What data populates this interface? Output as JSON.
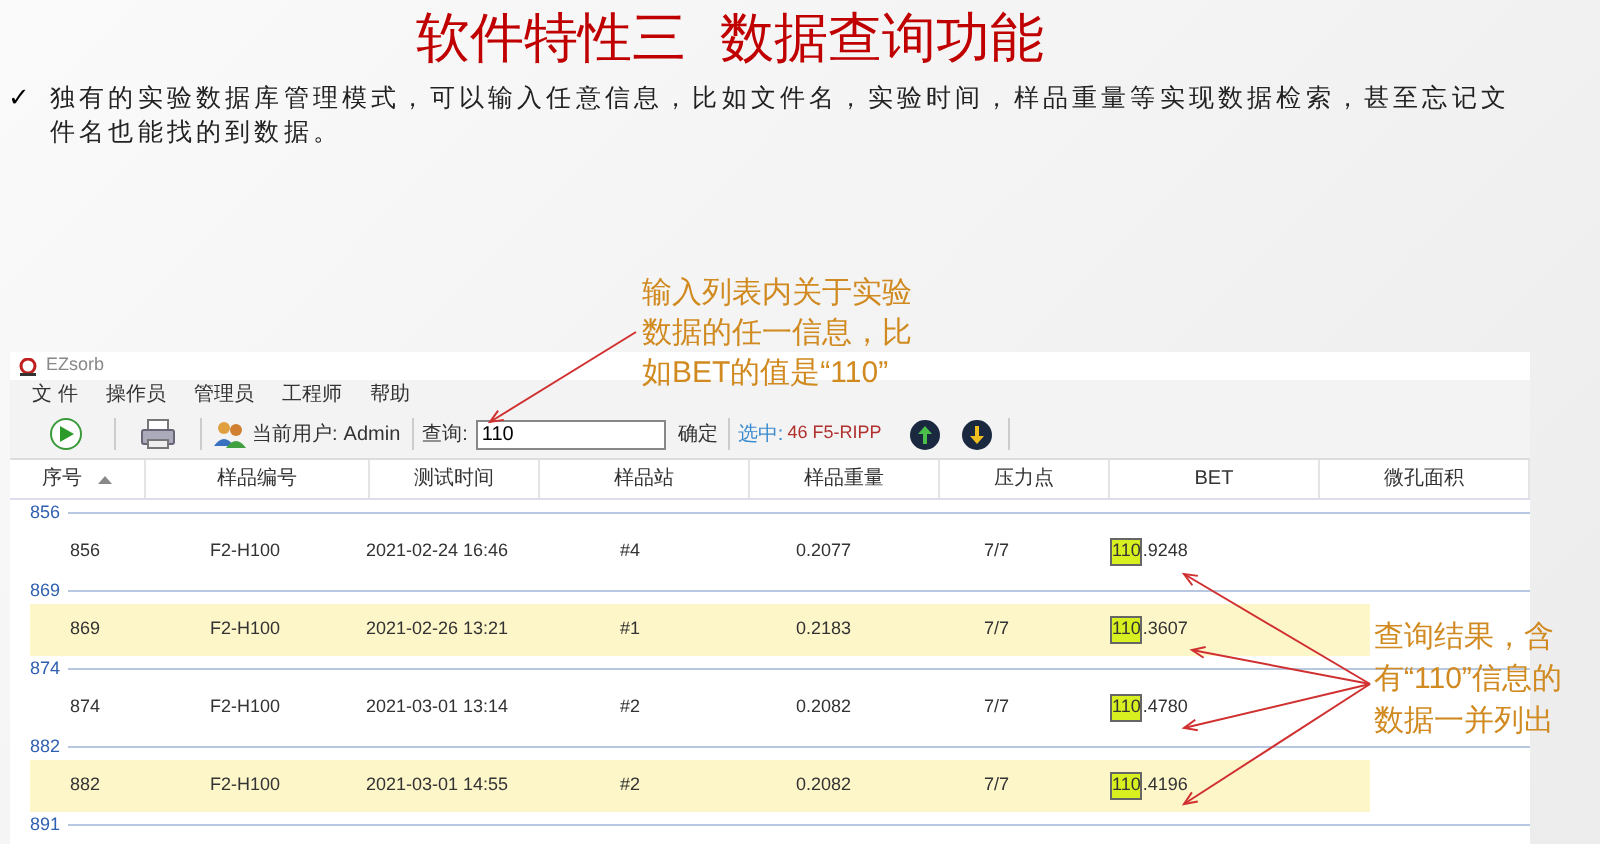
{
  "slide": {
    "title": "软件特性三  数据查询功能",
    "bullet_mark": "✓",
    "bullet": "独有的实验数据库管理模式，可以输入任意信息，比如文件名，实验时间，样品重量等实现数据检索，甚至忘记文件名也能找的到数据。"
  },
  "annotation_search": [
    "输入列表内关于实验",
    "数据的任一信息，比",
    "如BET的值是“110”"
  ],
  "annotation_results": [
    "查询结果，含",
    "有“110”信息的",
    "数据一并列出"
  ],
  "window": {
    "title": "EZsorb"
  },
  "menu": [
    "文 件",
    "操作员",
    "管理员",
    "工程师",
    "帮助"
  ],
  "toolbar": {
    "user_label": "当前用户:",
    "user": "Admin",
    "search_label": "查询:",
    "search_value": "110",
    "confirm": "确定",
    "selected_label": "选中:",
    "selected_value": "46 F5-RIPP"
  },
  "table": {
    "columns": [
      "序号",
      "样品编号",
      "测试时间",
      "样品站",
      "样品重量",
      "压力点",
      "BET",
      "微孔面积"
    ],
    "groups": [
      {
        "label": "856",
        "row": {
          "shaded": false,
          "cells": [
            "856",
            "F2-H100",
            "2021-02-24 16:46",
            "#4",
            "0.2077",
            "7/7"
          ],
          "bet_match": "110",
          "bet_rest": ".9248"
        }
      },
      {
        "label": "869",
        "row": {
          "shaded": true,
          "cells": [
            "869",
            "F2-H100",
            "2021-02-26 13:21",
            "#1",
            "0.2183",
            "7/7"
          ],
          "bet_match": "110",
          "bet_rest": ".3607"
        }
      },
      {
        "label": "874",
        "row": {
          "shaded": false,
          "cells": [
            "874",
            "F2-H100",
            "2021-03-01 13:14",
            "#2",
            "0.2082",
            "7/7"
          ],
          "bet_match": "110",
          "bet_rest": ".4780"
        }
      },
      {
        "label": "882",
        "row": {
          "shaded": true,
          "cells": [
            "882",
            "F2-H100",
            "2021-03-01 14:55",
            "#2",
            "0.2082",
            "7/7"
          ],
          "bet_match": "110",
          "bet_rest": ".4196"
        }
      },
      {
        "label": "891"
      }
    ]
  }
}
